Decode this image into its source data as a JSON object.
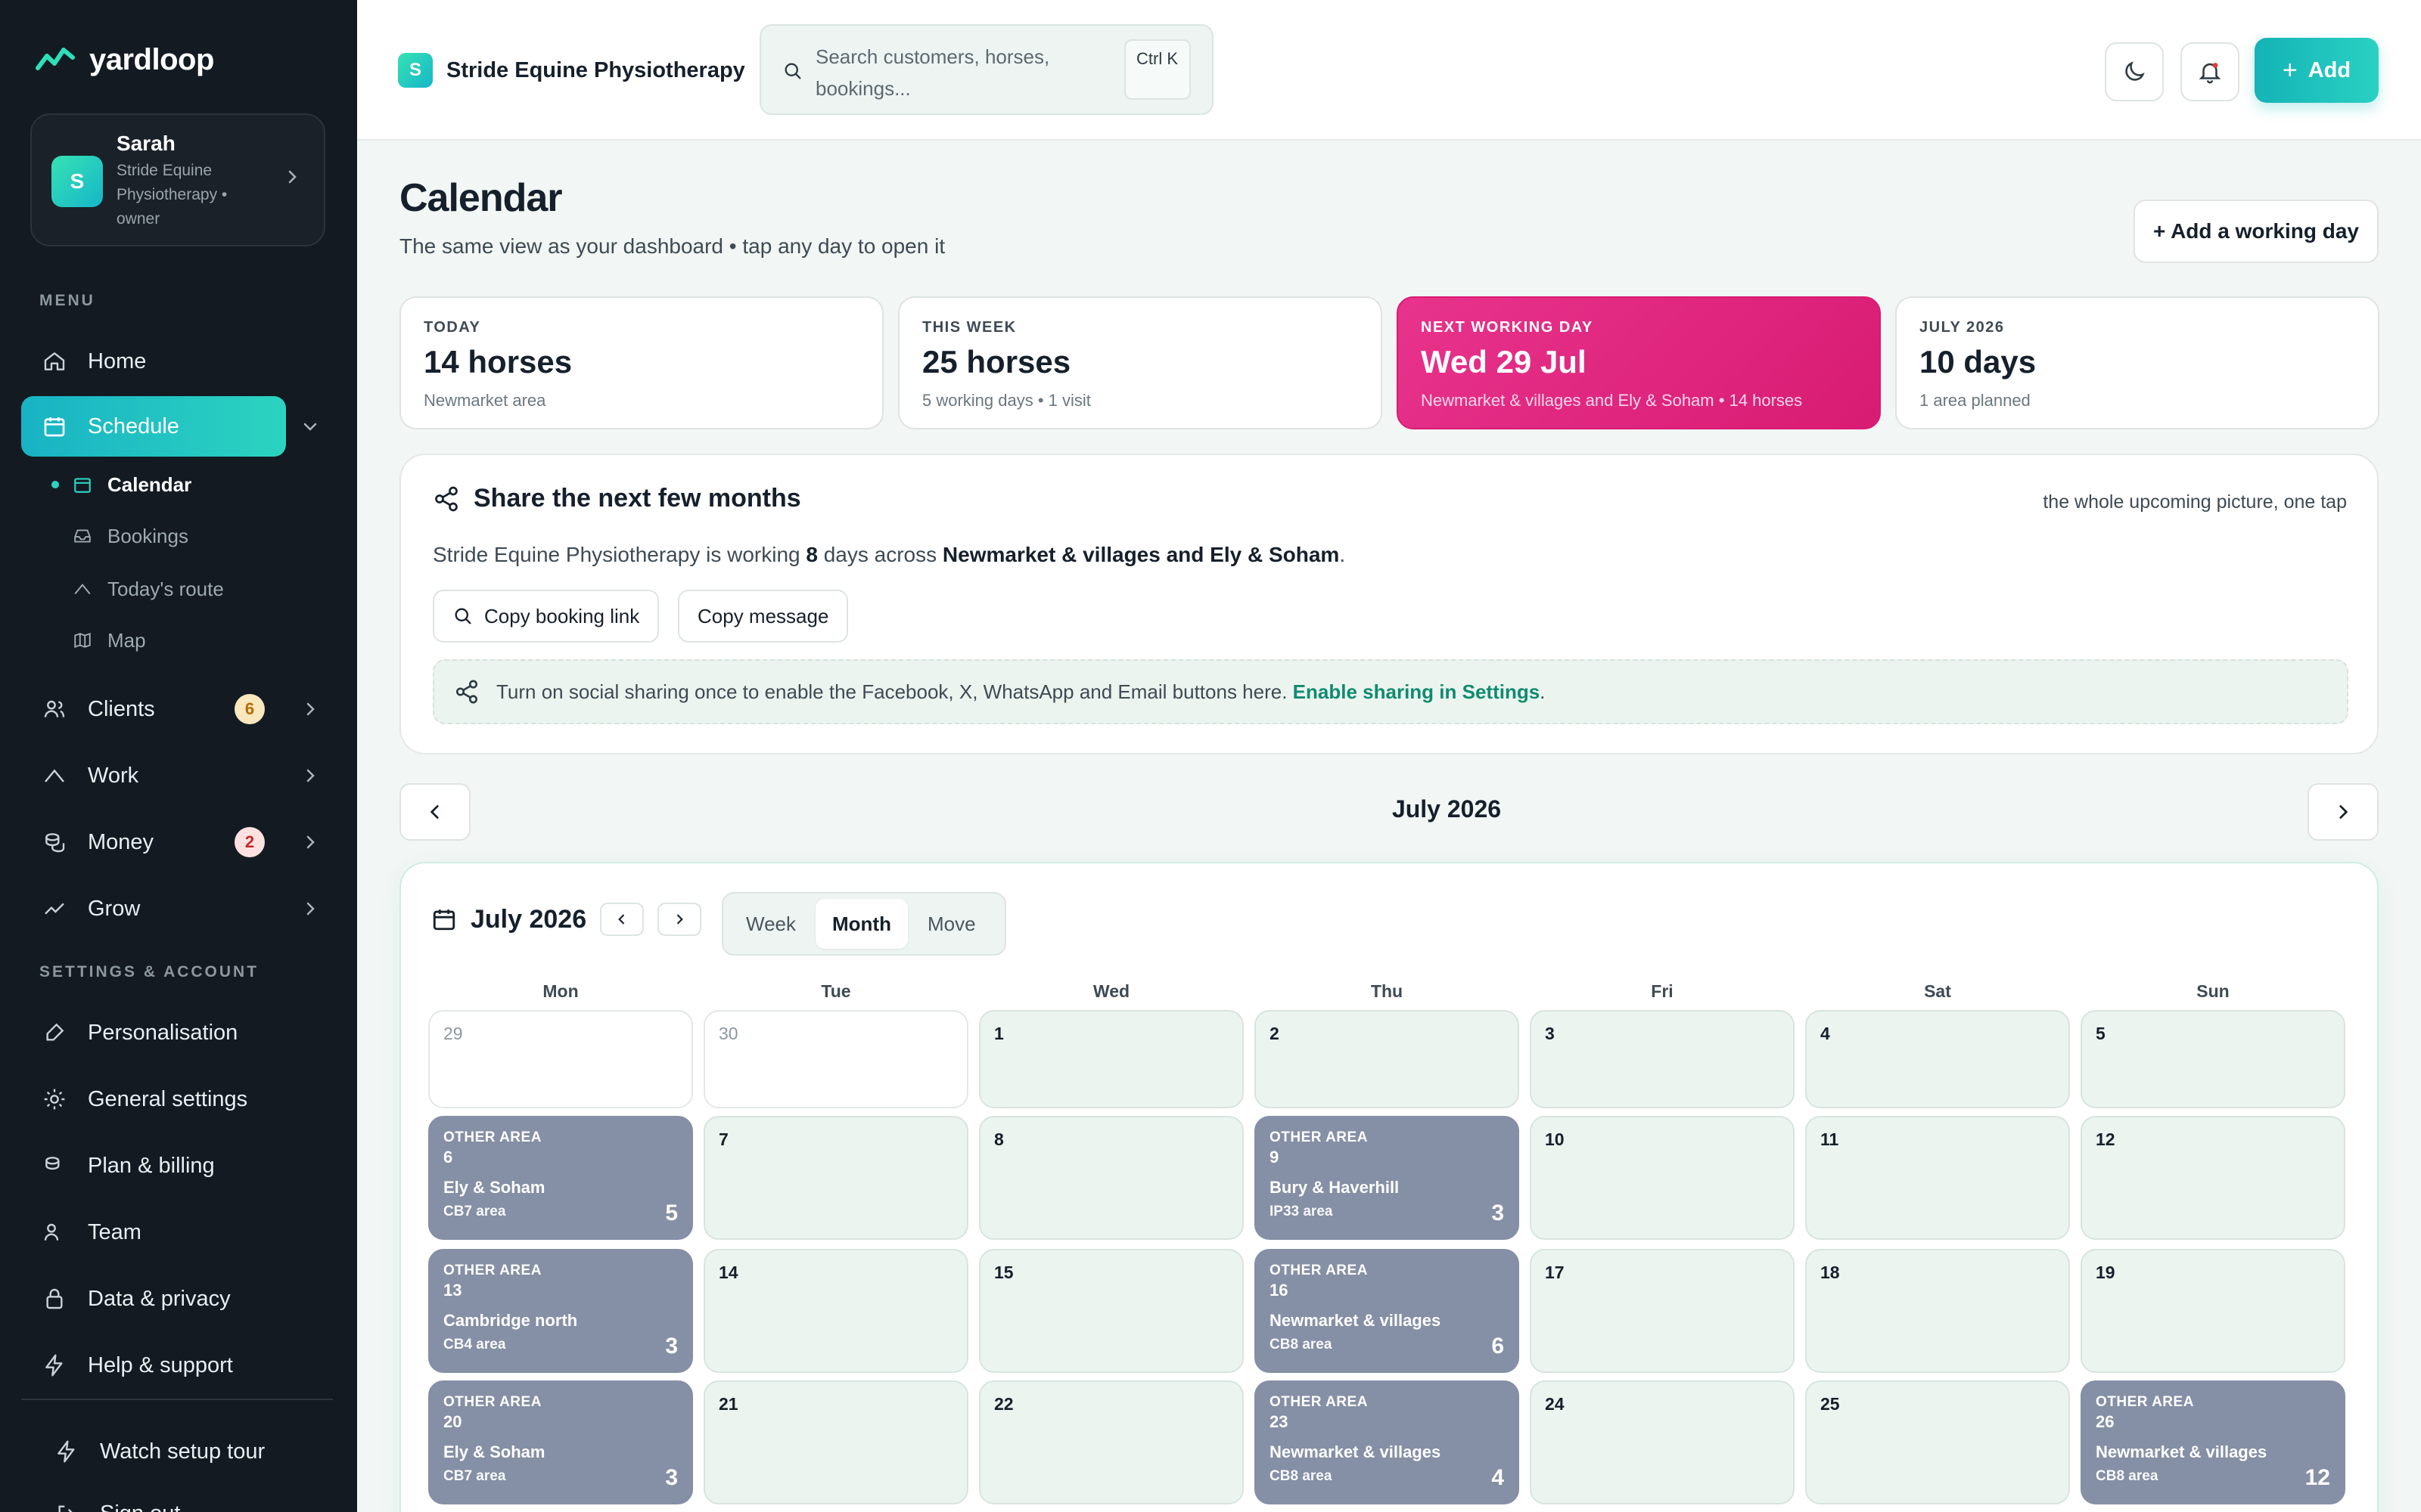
{
  "brand": {
    "name": "yardloop"
  },
  "user": {
    "name": "Sarah",
    "subtitle": "Stride Equine Physiotherapy • owner",
    "initial": "S"
  },
  "sidebar": {
    "menu_label": "MENU",
    "home": "Home",
    "schedule": "Schedule",
    "sub": {
      "calendar": "Calendar",
      "bookings": "Bookings",
      "route": "Today's route",
      "map": "Map"
    },
    "clients": "Clients",
    "clients_badge": "6",
    "work": "Work",
    "money": "Money",
    "money_badge": "2",
    "grow": "Grow",
    "settings_label": "SETTINGS & ACCOUNT",
    "personalisation": "Personalisation",
    "general_settings": "General settings",
    "plan_billing": "Plan & billing",
    "team": "Team",
    "data_privacy": "Data & privacy",
    "help": "Help & support",
    "tour": "Watch setup tour",
    "signout": "Sign out"
  },
  "topbar": {
    "business_initial": "S",
    "business_name": "Stride Equine Physiotherapy",
    "search_placeholder": "Search customers, horses, bookings...",
    "shortcut": "Ctrl K",
    "add_label": "Add"
  },
  "page": {
    "title": "Calendar",
    "subtitle": "The same view as your dashboard • tap any day to open it",
    "add_day": "+ Add a working day"
  },
  "stats": [
    {
      "key": "TODAY",
      "value": "14 horses",
      "detail": "Newmarket area"
    },
    {
      "key": "THIS WEEK",
      "value": "25 horses",
      "detail": "5 working days • 1 visit"
    },
    {
      "key": "NEXT WORKING DAY",
      "value": "Wed 29 Jul",
      "detail": "Newmarket & villages and Ely & Soham • 14 horses"
    },
    {
      "key": "JULY 2026",
      "value": "10 days",
      "detail": "1 area planned"
    }
  ],
  "share": {
    "title": "Share the next few months",
    "note": "the whole upcoming picture, one tap",
    "text_pre": "Stride Equine Physiotherapy is working ",
    "days": "8",
    "text_mid": " days across ",
    "areas": "Newmarket & villages and Ely & Soham",
    "text_end": ".",
    "copy_link": "Copy booking link",
    "copy_message": "Copy message",
    "banner_text": "Turn on social sharing once to enable the Facebook, X, WhatsApp and Email buttons here.",
    "banner_link": "Enable sharing in Settings",
    "banner_end": "."
  },
  "month_nav": {
    "label": "July 2026"
  },
  "calendar": {
    "title": "July 2026",
    "views": [
      "Week",
      "Month",
      "Move"
    ],
    "selected_view": "Month",
    "weekdays": [
      "Mon",
      "Tue",
      "Wed",
      "Thu",
      "Fri",
      "Sat",
      "Sun"
    ],
    "weeks": [
      [
        {
          "n": "29",
          "muted": true
        },
        {
          "n": "30",
          "muted": true
        },
        {
          "n": "1"
        },
        {
          "n": "2"
        },
        {
          "n": "3"
        },
        {
          "n": "4"
        },
        {
          "n": "5"
        }
      ],
      [
        {
          "n": "6",
          "tag": "OTHER AREA",
          "place": "Ely & Soham",
          "pc": "CB7 area",
          "count": "5"
        },
        {
          "n": "7"
        },
        {
          "n": "8"
        },
        {
          "n": "9",
          "tag": "OTHER AREA",
          "place": "Bury & Haverhill",
          "pc": "IP33 area",
          "count": "3"
        },
        {
          "n": "10"
        },
        {
          "n": "11"
        },
        {
          "n": "12"
        }
      ],
      [
        {
          "n": "13",
          "tag": "OTHER AREA",
          "place": "Cambridge north",
          "pc": "CB4 area",
          "count": "3"
        },
        {
          "n": "14"
        },
        {
          "n": "15"
        },
        {
          "n": "16",
          "tag": "OTHER AREA",
          "place": "Newmarket & villages",
          "pc": "CB8 area",
          "count": "6"
        },
        {
          "n": "17"
        },
        {
          "n": "18"
        },
        {
          "n": "19"
        }
      ],
      [
        {
          "n": "20",
          "tag": "OTHER AREA",
          "place": "Ely & Soham",
          "pc": "CB7 area",
          "count": "3"
        },
        {
          "n": "21"
        },
        {
          "n": "22"
        },
        {
          "n": "23",
          "tag": "OTHER AREA",
          "place": "Newmarket & villages",
          "pc": "CB8 area",
          "count": "4"
        },
        {
          "n": "24"
        },
        {
          "n": "25"
        },
        {
          "n": "26",
          "tag": "OTHER AREA",
          "place": "Newmarket & villages",
          "pc": "CB8 area",
          "count": "12"
        }
      ]
    ]
  },
  "colors": {
    "accent": "#20c4c0",
    "hot": "#e0287f",
    "area_day": "#858fa5",
    "sidebar": "#131a22"
  }
}
